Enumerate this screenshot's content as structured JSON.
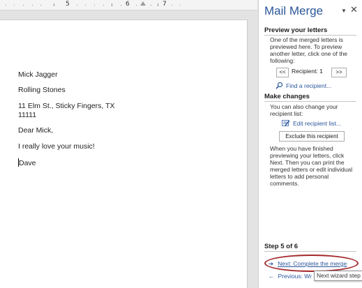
{
  "ruler": {
    "labels": [
      "5",
      "6",
      "7"
    ]
  },
  "document": {
    "lines": [
      "Mick Jagger",
      "Rolling Stones",
      "11 Elm St., Sticky Fingers, TX",
      "11111",
      "Dear Mick,",
      "I really love your music!",
      "Dave"
    ]
  },
  "pane": {
    "title": "Mail Merge",
    "menu_glyph": "▼",
    "close_glyph": "✕",
    "preview": {
      "heading": "Preview your letters",
      "text": "One of the merged letters is previewed here. To preview another letter, click one of the following:",
      "prev_button": "<<",
      "recipient_label": "Recipient: 1",
      "next_button": ">>",
      "find_link": "Find a recipient..."
    },
    "changes": {
      "heading": "Make changes",
      "text": "You can also change your recipient list:",
      "edit_link": "Edit recipient list...",
      "exclude_button": "Exclude this recipient",
      "text2": "When you have finished previewing your letters, click Next. Then you can print the merged letters or edit individual letters to add personal comments."
    },
    "step": {
      "label": "Step 5 of 6",
      "next_link": "Next: Complete the merge",
      "prev_link": "Previous: Wr"
    }
  },
  "tooltip": "Next wizard step",
  "colors": {
    "accent": "#2b579a",
    "highlight_ellipse": "#a3262a"
  }
}
